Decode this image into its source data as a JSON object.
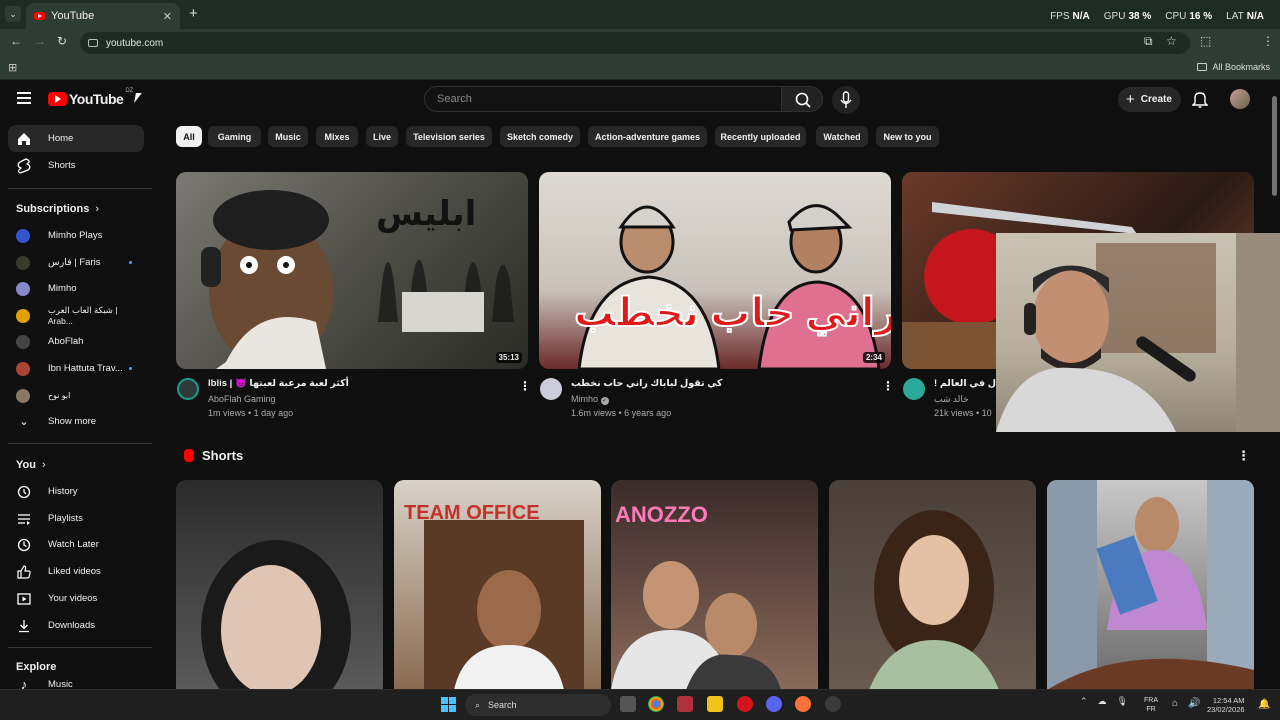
{
  "browser": {
    "tab_title": "YouTube",
    "tab_close": "✕",
    "new_tab": "+",
    "url": "youtube.com",
    "all_bookmarks": "All Bookmarks",
    "stats": [
      {
        "label": "FPS",
        "value": "N/A"
      },
      {
        "label": "GPU",
        "value": "38 %"
      },
      {
        "label": "CPU",
        "value": "16 %"
      },
      {
        "label": "LAT",
        "value": "N/A"
      }
    ]
  },
  "header": {
    "logo_text": "YouTube",
    "region": "DZ",
    "search_placeholder": "Search",
    "create_label": "Create"
  },
  "sidebar": {
    "main": [
      {
        "label": "Home",
        "icon": "home-icon"
      },
      {
        "label": "Shorts",
        "icon": "shorts-icon"
      }
    ],
    "subscriptions_heading": "Subscriptions",
    "subscriptions": [
      {
        "label": "Mimho Plays",
        "color": "#3355cc",
        "dot": false
      },
      {
        "label": "فارس | Faris",
        "color": "#333333",
        "dot": true
      },
      {
        "label": "Mimho",
        "color": "#8888cc",
        "dot": false
      },
      {
        "label": "شبكة العاب العرب | Arab...",
        "color": "#e0a000",
        "dot": true
      },
      {
        "label": "AboFlah",
        "color": "#444444",
        "dot": false
      },
      {
        "label": "Ibn Hattuta Trav...",
        "color": "#aa4433",
        "dot": true
      },
      {
        "label": "ابو نوح",
        "color": "#887766",
        "dot": false
      }
    ],
    "show_more": "Show more",
    "you_heading": "You",
    "you_items": [
      {
        "label": "History",
        "icon": "history-icon"
      },
      {
        "label": "Playlists",
        "icon": "playlists-icon"
      },
      {
        "label": "Watch Later",
        "icon": "watch-later-icon"
      },
      {
        "label": "Liked videos",
        "icon": "like-icon"
      },
      {
        "label": "Your videos",
        "icon": "your-videos-icon"
      },
      {
        "label": "Downloads",
        "icon": "download-icon"
      }
    ],
    "explore_heading": "Explore",
    "explore_partial": "Music"
  },
  "chips": [
    "All",
    "Gaming",
    "Music",
    "Mixes",
    "Live",
    "Television series",
    "Sketch comedy",
    "Action-adventure games",
    "Recently uploaded",
    "Watched",
    "New to you"
  ],
  "videos": [
    {
      "title": "Iblis | 👿 أكثر لعبة مرعبة لعبتها",
      "channel": "AboFlah Gaming",
      "meta": "1m views • 1 day ago",
      "duration": "35:13",
      "thumb_text": "ابليس"
    },
    {
      "title": "كي تقول لباباك راني حاب نخطب",
      "channel": "Mimho",
      "meta": "1.6m views • 6 years ago",
      "duration": "2:34",
      "thumb_text": "راني حاب نخطب"
    },
    {
      "title": "! ع المعال في العالم",
      "channel": "خالد شب",
      "meta": "21k views • 10",
      "duration": "",
      "thumb_text": ""
    }
  ],
  "shorts": {
    "heading": "Shorts",
    "items": [
      {
        "bg": "#3a3a3a",
        "overlay": ""
      },
      {
        "bg": "#6b4a3a",
        "overlay": "TEAM OFFICE"
      },
      {
        "bg": "#4a3a3a",
        "overlay": "ANOZZO"
      },
      {
        "bg": "#5a4d45",
        "overlay": ""
      },
      {
        "bg": "#8a8a8a",
        "overlay": ""
      }
    ]
  },
  "taskbar": {
    "search_label": "Search",
    "lang_top": "FRA",
    "lang_bottom": "FR",
    "time": "12:54 AM",
    "date": "23/02/2026"
  }
}
